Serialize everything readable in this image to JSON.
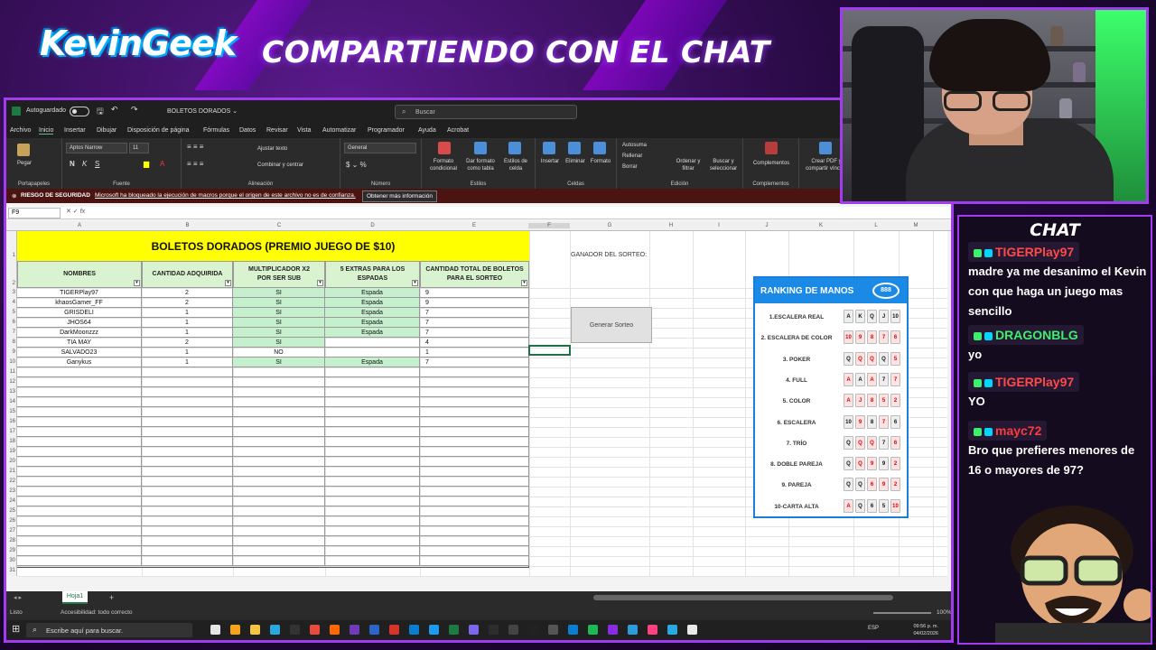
{
  "stream": {
    "logo_text": "KevinGeek",
    "headline": "COMPARTIENDO CON EL CHAT"
  },
  "excel": {
    "titlebar": {
      "autosave_label": "Autoguardado",
      "file_name": "BOLETOS DORADOS ⌄",
      "search_placeholder": "Buscar"
    },
    "menu": [
      "Archivo",
      "Inicio",
      "Insertar",
      "Dibujar",
      "Disposición de página",
      "Fórmulas",
      "Datos",
      "Revisar",
      "Vista",
      "Automatizar",
      "Programador",
      "Ayuda",
      "Acrobat"
    ],
    "ribbon": {
      "paste": "Pegar",
      "clipboard": "Portapapeles",
      "font_name": "Aptos Narrow",
      "font_size": "11",
      "font_group": "Fuente",
      "wrap_text": "Ajustar texto",
      "merge_center": "Combinar y centrar",
      "alignment_group": "Alineación",
      "number_format": "General",
      "number_group": "Número",
      "cond_format": "Formato condicional",
      "format_table": "Dar formato como tabla",
      "cell_styles": "Estilos de celda",
      "styles_group": "Estilos",
      "insert": "Insertar",
      "delete": "Eliminar",
      "format": "Formato",
      "cells_group": "Celdas",
      "autosum": "Autosuma",
      "fill": "Rellenar",
      "clear": "Borrar",
      "sort_filter": "Ordenar y filtrar",
      "find_select": "Buscar y seleccionar",
      "editing_group": "Edición",
      "addins": "Complementos",
      "addins_group": "Complementos",
      "create_pdf": "Crear PDF y compartir vínculo"
    },
    "security_bar": {
      "label": "RIESGO DE SEGURIDAD",
      "message": "Microsoft ha bloqueado la ejecución de macros porque el origen de este archivo no es de confianza.",
      "button": "Obtener más información"
    },
    "name_box": "F9",
    "columns": [
      "A",
      "B",
      "C",
      "D",
      "E",
      "F",
      "G",
      "H",
      "I",
      "J",
      "K",
      "L",
      "M"
    ],
    "rows": [
      "1",
      "2",
      "3",
      "4",
      "5",
      "6",
      "7",
      "8",
      "9",
      "10",
      "11",
      "12",
      "13",
      "14",
      "15",
      "16",
      "17",
      "18",
      "19",
      "20",
      "21",
      "22",
      "23",
      "24",
      "25",
      "26",
      "27",
      "28",
      "29",
      "30",
      "31"
    ],
    "table_title": "BOLETOS DORADOS (PREMIO JUEGO DE $10)",
    "headers": [
      "NOMBRES",
      "CANTIDAD ADQUIRIDA",
      "MULTIPLICADOR X2 POR SER SUB",
      "5 EXTRAS PARA LOS ESPADAS",
      "CANTIDAD TOTAL DE BOLETOS PARA EL SORTEO"
    ],
    "entries": [
      {
        "name": "TIGERPlay97",
        "qty": "2",
        "sub": "SI",
        "extra": "Espada",
        "total": "9"
      },
      {
        "name": "khaosGamer_FF",
        "qty": "2",
        "sub": "SI",
        "extra": "Espada",
        "total": "9"
      },
      {
        "name": "GRISDELI",
        "qty": "1",
        "sub": "SI",
        "extra": "Espada",
        "total": "7"
      },
      {
        "name": "JHOS64",
        "qty": "1",
        "sub": "SI",
        "extra": "Espada",
        "total": "7"
      },
      {
        "name": "DarkMoonzzz",
        "qty": "1",
        "sub": "SI",
        "extra": "Espada",
        "total": "7"
      },
      {
        "name": "TIA MAY",
        "qty": "2",
        "sub": "SI",
        "extra": "",
        "total": "4"
      },
      {
        "name": "SALVADO23",
        "qty": "1",
        "sub": "NO",
        "extra": "",
        "total": "1"
      },
      {
        "name": "Ganykus",
        "qty": "1",
        "sub": "SI",
        "extra": "Espada",
        "total": "7"
      }
    ],
    "winner_label": "GANADOR DEL SORTEO:",
    "generate_button": "Generar Sorteo",
    "ranking": {
      "title": "RANKING DE MANOS",
      "badge": "888",
      "hands": [
        {
          "name": "1.ESCALERA REAL",
          "cards": [
            "A",
            "K",
            "Q",
            "J",
            "10"
          ],
          "colors": [
            "b",
            "b",
            "b",
            "b",
            "b"
          ]
        },
        {
          "name": "2. ESCALERA DE COLOR",
          "cards": [
            "10",
            "9",
            "8",
            "7",
            "6"
          ],
          "colors": [
            "r",
            "r",
            "r",
            "r",
            "r"
          ]
        },
        {
          "name": "3. POKER",
          "cards": [
            "Q",
            "Q",
            "Q",
            "Q",
            "5"
          ],
          "colors": [
            "b",
            "r",
            "r",
            "b",
            "r"
          ]
        },
        {
          "name": "4. FULL",
          "cards": [
            "A",
            "A",
            "A",
            "7",
            "7"
          ],
          "colors": [
            "r",
            "b",
            "r",
            "b",
            "r"
          ]
        },
        {
          "name": "5. COLOR",
          "cards": [
            "A",
            "J",
            "8",
            "5",
            "2"
          ],
          "colors": [
            "r",
            "r",
            "r",
            "r",
            "r"
          ]
        },
        {
          "name": "6. ESCALERA",
          "cards": [
            "10",
            "9",
            "8",
            "7",
            "6"
          ],
          "colors": [
            "b",
            "r",
            "b",
            "r",
            "b"
          ]
        },
        {
          "name": "7. TRÍO",
          "cards": [
            "Q",
            "Q",
            "Q",
            "7",
            "6"
          ],
          "colors": [
            "b",
            "r",
            "r",
            "b",
            "r"
          ]
        },
        {
          "name": "8. DOBLE PAREJA",
          "cards": [
            "Q",
            "Q",
            "9",
            "9",
            "2"
          ],
          "colors": [
            "b",
            "r",
            "r",
            "b",
            "r"
          ]
        },
        {
          "name": "9. PAREJA",
          "cards": [
            "Q",
            "Q",
            "6",
            "9",
            "2"
          ],
          "colors": [
            "b",
            "b",
            "r",
            "r",
            "r"
          ]
        },
        {
          "name": "10-CARTA ALTA",
          "cards": [
            "A",
            "Q",
            "6",
            "5",
            "10"
          ],
          "colors": [
            "r",
            "b",
            "b",
            "b",
            "r"
          ]
        }
      ]
    },
    "sheet_tab": "Hoja1",
    "status_ready": "Listo",
    "status_access": "Accesibilidad: todo correcto",
    "zoom": "100%",
    "taskbar_search": "Escribe aquí para buscar.",
    "clock_time": "09:56 p. m.",
    "clock_date": "04/02/2026",
    "lang": "ESP"
  },
  "chat": {
    "title": "CHAT",
    "messages": [
      {
        "user": "TIGERPlay97",
        "color": "#ff4a4a",
        "text": "madre ya me desanimo el Kevin con que haga un juego mas sencillo"
      },
      {
        "user": "DRAGONBLG",
        "color": "#3cf06b",
        "text": "yo"
      },
      {
        "user": "TIGERPlay97",
        "color": "#ff4a4a",
        "text": "YO"
      },
      {
        "user": "mayc72",
        "color": "#ff3b3b",
        "text": "Bro que prefieres menores de 16 o mayores de 97?"
      }
    ]
  }
}
